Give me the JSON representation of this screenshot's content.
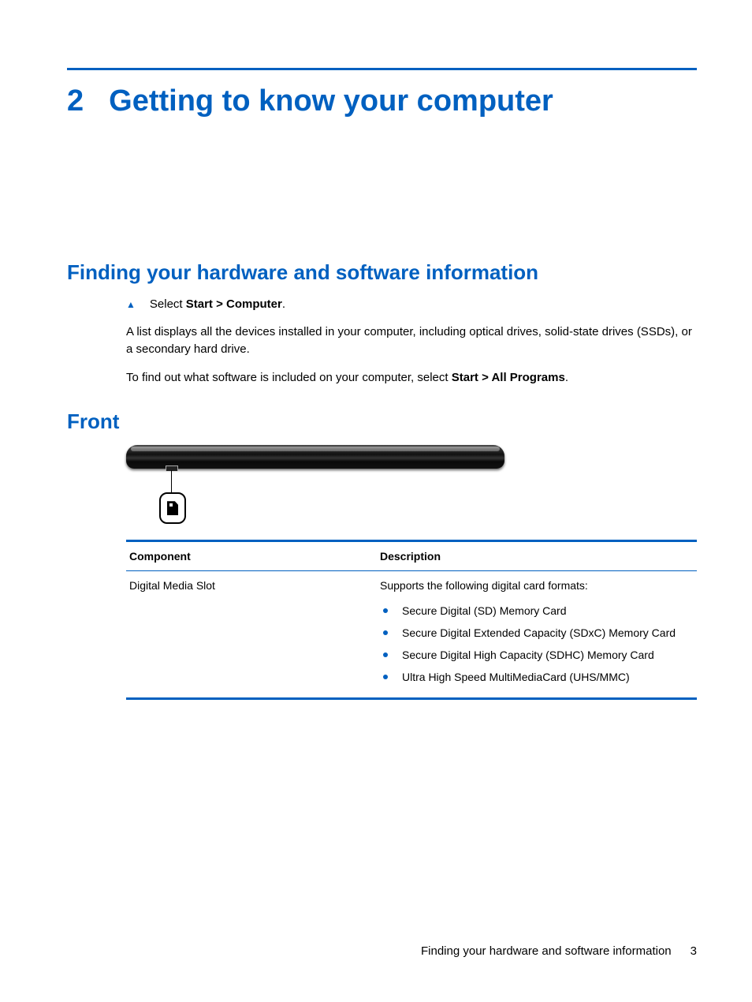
{
  "chapter": {
    "number": "2",
    "title": "Getting to know your computer"
  },
  "section1": {
    "heading": "Finding your hardware and software information",
    "step_prefix": "Select ",
    "step_bold": "Start > Computer",
    "step_suffix": ".",
    "para1": "A list displays all the devices installed in your computer, including optical drives, solid-state drives (SSDs), or a secondary hard drive.",
    "para2_prefix": "To find out what software is included on your computer, select ",
    "para2_bold": "Start > All Programs",
    "para2_suffix": "."
  },
  "section2": {
    "heading": "Front"
  },
  "table": {
    "headers": {
      "component": "Component",
      "description": "Description"
    },
    "rows": [
      {
        "component": "Digital Media Slot",
        "description_lead": "Supports the following digital card formats:",
        "items": [
          "Secure Digital (SD) Memory Card",
          "Secure Digital Extended Capacity (SDxC) Memory Card",
          "Secure Digital High Capacity (SDHC) Memory Card",
          "Ultra High Speed MultiMediaCard (UHS/MMC)"
        ]
      }
    ]
  },
  "footer": {
    "section_ref": "Finding your hardware and software information",
    "page_number": "3"
  }
}
